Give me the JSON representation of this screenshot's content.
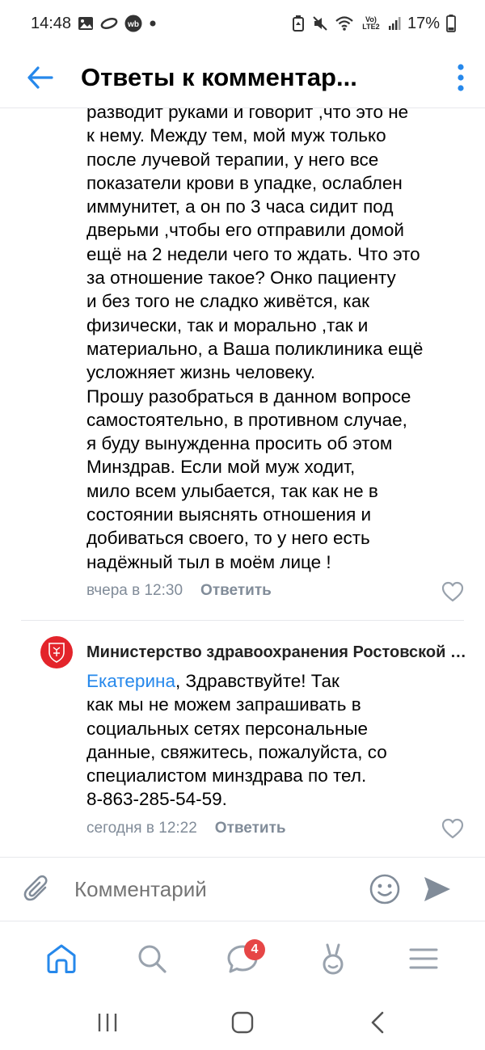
{
  "status_bar": {
    "time": "14:48",
    "battery": "17%",
    "network": "Vo) LTE2"
  },
  "header": {
    "title": "Ответы к комментар..."
  },
  "comments": [
    {
      "text": "разводит руками и говорит ,что это не\nк нему. Между тем, мой муж только\nпосле лучевой терапии, у него все\nпоказатели крови в упадке, ослаблен\nиммунитет, а он по 3 часа сидит под\nдверьми ,чтобы его отправили домой\nещё на 2 недели чего то ждать. Что это\nза отношение такое? Онко пациенту\nи без того не сладко живётся, как\nфизически, так и морально ,так и\nматериально, а Ваша поликлиника ещё\nусложняет жизнь человеку.\nПрошу разобраться в данном вопросе\nсамостоятельно,  в противном случае,\nя буду вынужденна просить об этом\nМинздрав. Если мой муж ходит,\nмило всем улыбается, так как не в\nсостоянии выяснять отношения и\nдобиваться своего, то у него есть\nнадёжный тыл в моём лице !",
      "time": "вчера в 12:30",
      "reply": "Ответить"
    },
    {
      "author": "Министерство здравоохранения Ростовской области",
      "mention": "Екатерина",
      "text": ", Здравствуйте! Так\nкак мы не можем запрашивать в\nсоциальных сетях персональные\nданные, свяжитесь, пожалуйста, со\nспециалистом минздрава по тел.\n8-863-285-54-59.",
      "time": "сегодня в 12:22",
      "reply": "Ответить"
    }
  ],
  "composer": {
    "placeholder": "Комментарий"
  },
  "tabbar": {
    "messages_badge": "4",
    "accent": "#2688eb",
    "icon_color": "#99a2ad"
  },
  "icons": [
    "back-arrow-icon",
    "more-vertical-icon",
    "heart-icon",
    "paperclip-icon",
    "smile-icon",
    "send-icon",
    "home-icon",
    "search-icon",
    "messages-icon",
    "clips-icon",
    "menu-icon"
  ]
}
